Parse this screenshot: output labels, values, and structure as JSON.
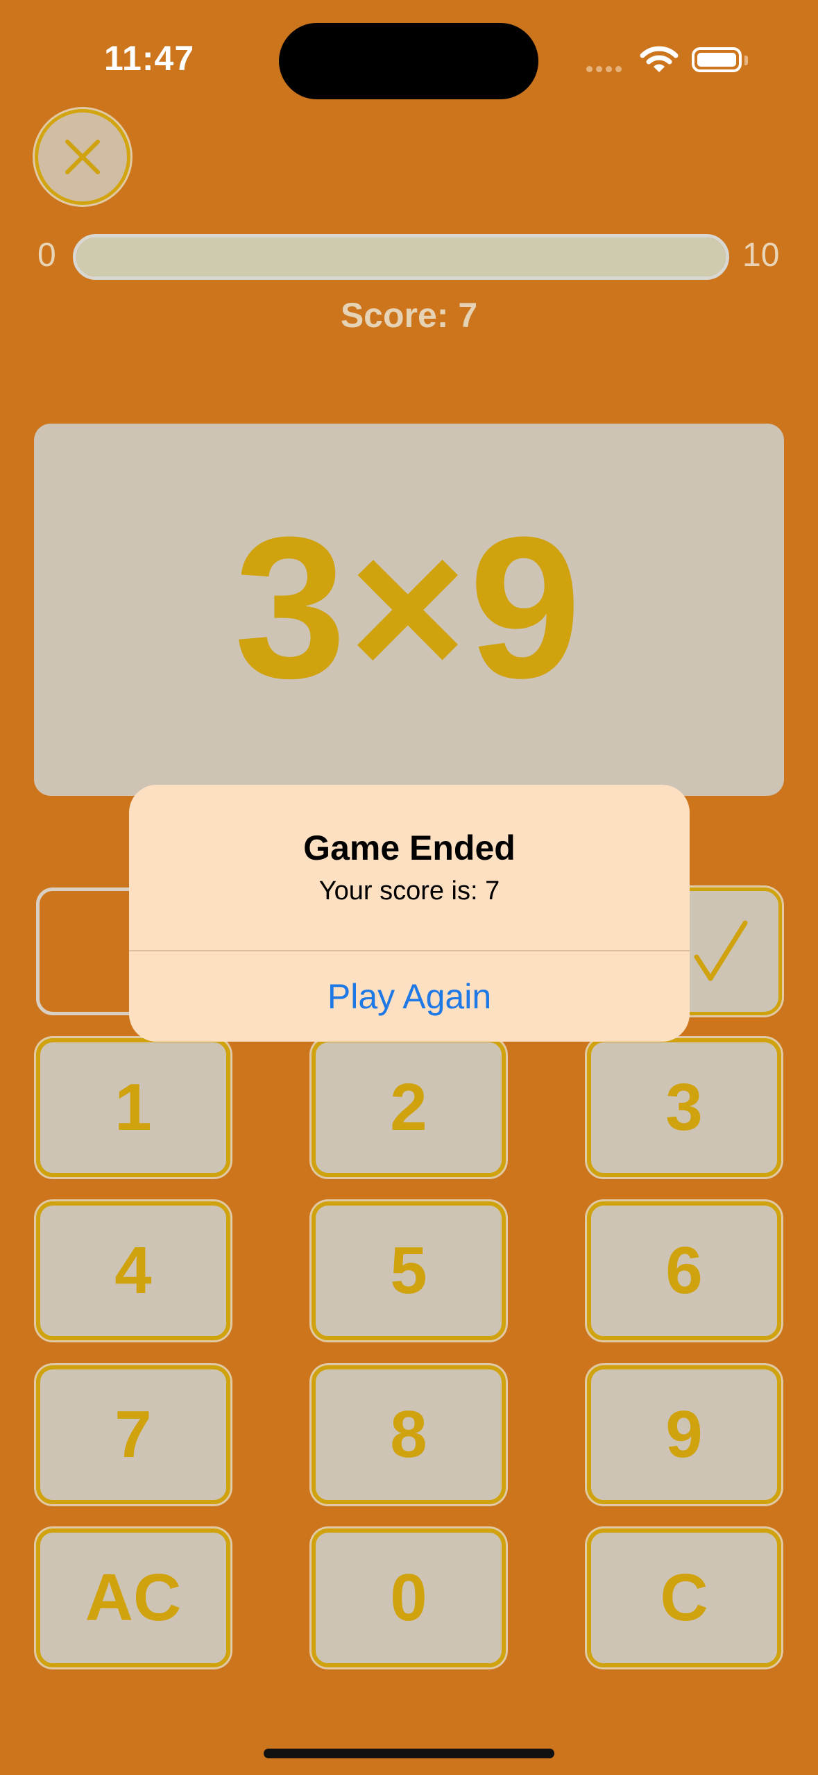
{
  "status_bar": {
    "time": "11:47"
  },
  "header": {
    "close_icon": "close-icon"
  },
  "progress": {
    "min_label": "0",
    "max_label": "10",
    "value_fraction": 1.0
  },
  "score": {
    "label": "Score: 7"
  },
  "question": {
    "text": "3×9"
  },
  "answer": {
    "value": "",
    "submit_icon": "checkmark-icon"
  },
  "keypad": {
    "keys": [
      "1",
      "2",
      "3",
      "4",
      "5",
      "6",
      "7",
      "8",
      "9",
      "AC",
      "0",
      "C"
    ]
  },
  "alert": {
    "title": "Game Ended",
    "message": "Your score is: 7",
    "button_label": "Play Again"
  },
  "colors": {
    "background": "#CC751C",
    "card": "#CEC4B5",
    "accent": "#CFA20E",
    "alert_background": "#FDE0C2",
    "alert_button": "#1E78E6"
  }
}
